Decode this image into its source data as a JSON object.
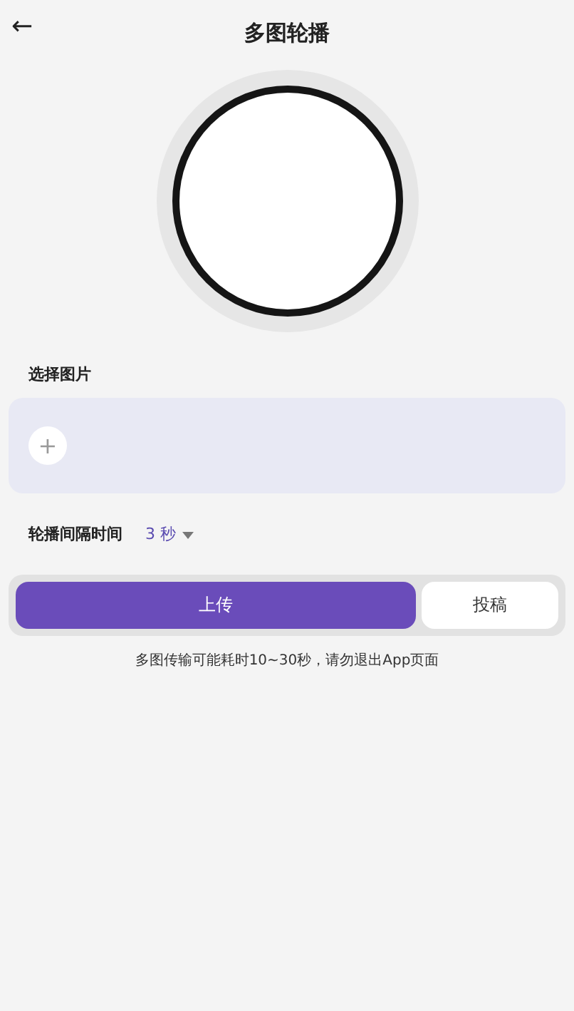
{
  "header": {
    "back": "←",
    "title": "多图轮播"
  },
  "preview": {
    "kind": "circle"
  },
  "image_picker": {
    "label": "选择图片",
    "add": "+"
  },
  "interval": {
    "label": "轮播间隔时间",
    "value": "3 秒"
  },
  "buttons": [
    {
      "label": "上传",
      "kind": "primary"
    },
    {
      "label": "投稿",
      "kind": "secondary"
    }
  ],
  "note": "多图传输可能耗时10~30秒，请勿退出App页面"
}
